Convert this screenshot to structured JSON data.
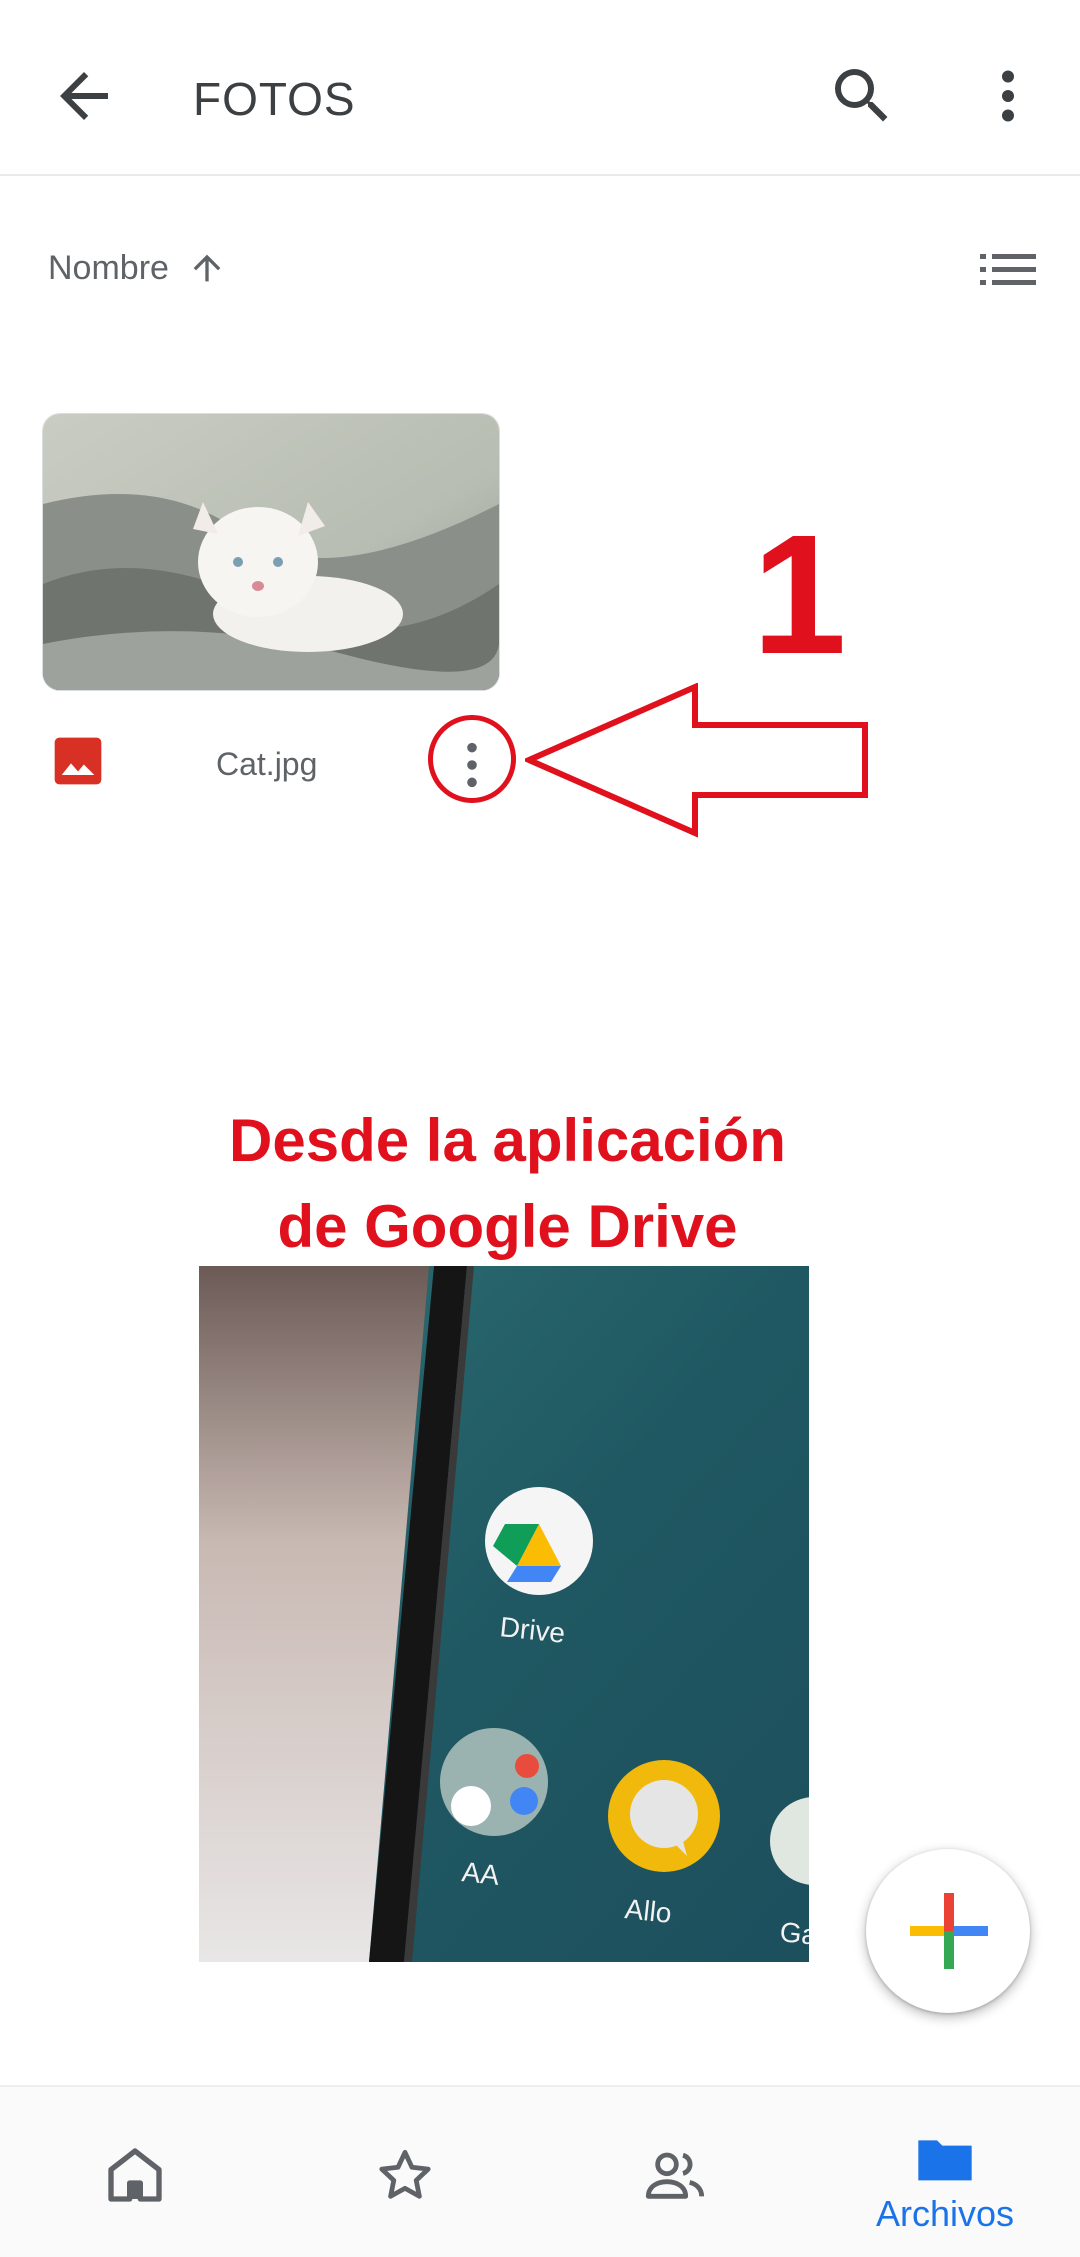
{
  "header": {
    "title": "FOTOS",
    "icons": [
      "back-arrow-icon",
      "search-icon",
      "more-vert-icon"
    ]
  },
  "sort": {
    "label": "Nombre",
    "direction_icon": "arrow-up-icon",
    "view_toggle_icon": "list-view-icon"
  },
  "files": [
    {
      "name": "Cat.jpg",
      "type_icon": "image-file-icon",
      "menu_icon": "more-vert-icon"
    }
  ],
  "annotation": {
    "step_number": "1",
    "caption_line1": "Desde la aplicación",
    "caption_line2": "de Google Drive",
    "color": "#e0101d"
  },
  "photo_labels": {
    "drive": "Drive",
    "aa": "AA",
    "allo": "Allo",
    "partial": "Ga"
  },
  "fab": {
    "icon": "google-plus-icon"
  },
  "bottom_nav": {
    "items": [
      {
        "icon": "home-icon",
        "active": false
      },
      {
        "icon": "star-icon",
        "active": false
      },
      {
        "icon": "shared-people-icon",
        "active": false
      },
      {
        "icon": "folder-icon",
        "label": "Archivos",
        "active": true
      }
    ],
    "active_color": "#1a73e8"
  }
}
